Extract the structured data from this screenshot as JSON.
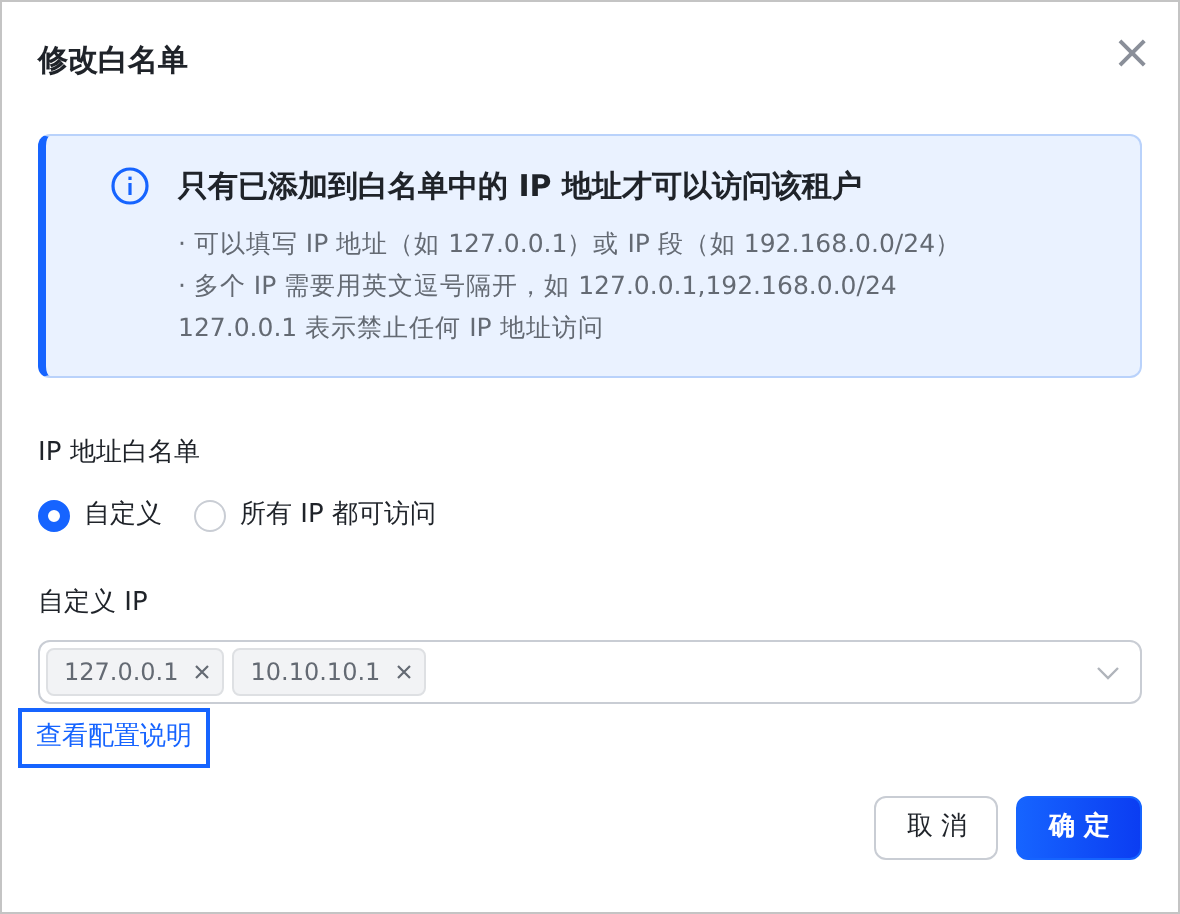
{
  "dialog": {
    "title": "修改白名单",
    "close": "×"
  },
  "alert": {
    "title": "只有已添加到白名单中的 IP 地址才可以访问该租户",
    "lines": [
      "· 可以填写 IP 地址（如 127.0.0.1）或 IP 段（如 192.168.0.0/24）",
      "· 多个 IP 需要用英文逗号隔开，如 127.0.0.1,192.168.0.0/24",
      "127.0.0.1 表示禁止任何 IP 地址访问"
    ]
  },
  "whitelist": {
    "label": "IP 地址白名单",
    "options": [
      {
        "label": "自定义",
        "selected": true
      },
      {
        "label": "所有 IP 都可访问",
        "selected": false
      }
    ]
  },
  "custom_ip": {
    "label": "自定义 IP",
    "tags": [
      "127.0.0.1",
      "10.10.10.1"
    ]
  },
  "help_link": {
    "label": "查看配置说明",
    "focused": true
  },
  "buttons": [
    {
      "label": "取 消",
      "kind": "secondary"
    },
    {
      "label": "确 定",
      "kind": "primary"
    }
  ]
}
